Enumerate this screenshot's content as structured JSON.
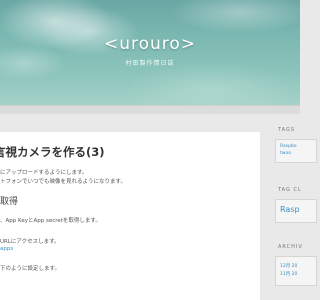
{
  "header": {
    "title": "<urouro>",
    "description": "村田製作情日誌"
  },
  "post": {
    "title": "言視カメラを作る(3)",
    "intro_lines": [
      "にアップロードするようにします。",
      "トフォンでいつでも映像を見れるようになります。"
    ],
    "section_heading": "取得",
    "step1": "、App KeyとApp secretを取得します。",
    "step2": "URLにアクセスします。",
    "step2_link": "apps",
    "step3": "下のように設定します。"
  },
  "sidebar": {
    "tags_heading": "TAGS",
    "tags": [
      "Raspbe",
      "twoo"
    ],
    "tag_cloud_heading": "TAG CL",
    "tag_cloud_item": "Rasp",
    "archive_heading": "ARCHIV",
    "archive_items": [
      "12月 20",
      "11月 20"
    ]
  }
}
